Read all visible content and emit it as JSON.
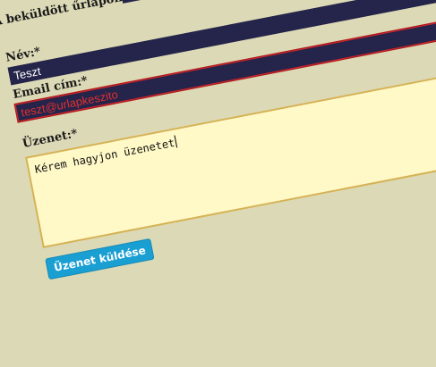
{
  "form": {
    "error_message": "A beküldött űrlapon hibák vannak",
    "name_label": "Név:*",
    "name_value": "Teszt",
    "email_label": "Email cím:*",
    "email_value": "teszt@urlapkeszito",
    "message_label": "Üzenet:*",
    "message_value": "Kérem hagyjon üzenetet",
    "submit_label": "Üzenet küldése"
  },
  "colors": {
    "background": "#dcd9b6",
    "input_dark": "#25244a",
    "error_red": "#d8262a",
    "textarea_bg": "#fff8c7",
    "textarea_border": "#d4b256",
    "button_blue": "#1a9fd2"
  }
}
